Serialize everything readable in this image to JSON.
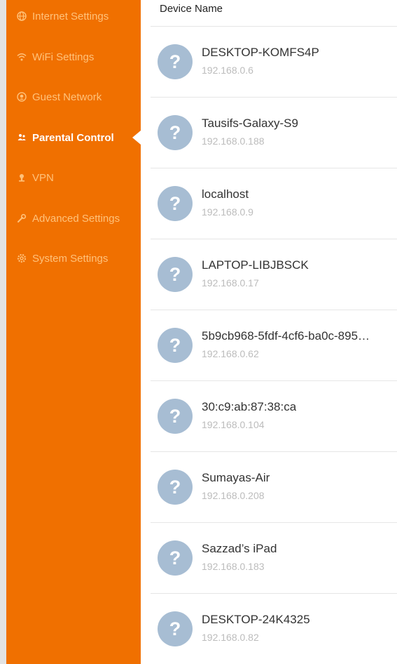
{
  "sidebar": {
    "items": [
      {
        "label": "Internet Settings",
        "icon": "globe-icon"
      },
      {
        "label": "WiFi Settings",
        "icon": "wifi-icon"
      },
      {
        "label": "Guest Network",
        "icon": "guest-network-icon"
      },
      {
        "label": "Parental Control",
        "icon": "parental-control-icon",
        "active": true
      },
      {
        "label": "VPN",
        "icon": "vpn-icon"
      },
      {
        "label": "Advanced Settings",
        "icon": "wrench-icon"
      },
      {
        "label": "System Settings",
        "icon": "gear-icon"
      }
    ]
  },
  "table": {
    "column_header": "Device Name",
    "devices": [
      {
        "name": "DESKTOP-KOMFS4P",
        "ip": "192.168.0.6",
        "avatar": "?"
      },
      {
        "name": "Tausifs-Galaxy-S9",
        "ip": "192.168.0.188",
        "avatar": "?"
      },
      {
        "name": "localhost",
        "ip": "192.168.0.9",
        "avatar": "?"
      },
      {
        "name": "LAPTOP-LIBJBSCK",
        "ip": "192.168.0.17",
        "avatar": "?"
      },
      {
        "name": "5b9cb968-5fdf-4cf6-ba0c-895…",
        "ip": "192.168.0.62",
        "avatar": "?"
      },
      {
        "name": "30:c9:ab:87:38:ca",
        "ip": "192.168.0.104",
        "avatar": "?"
      },
      {
        "name": "Sumayas-Air",
        "ip": "192.168.0.208",
        "avatar": "?"
      },
      {
        "name": "Sazzad’s iPad",
        "ip": "192.168.0.183",
        "avatar": "?"
      },
      {
        "name": "DESKTOP-24K4325",
        "ip": "192.168.0.82",
        "avatar": "?"
      }
    ]
  },
  "colors": {
    "sidebar_bg": "#f07000",
    "sidebar_text": "#ffc27a",
    "active_text": "#ffffff",
    "avatar_bg": "#a7bdd3"
  }
}
